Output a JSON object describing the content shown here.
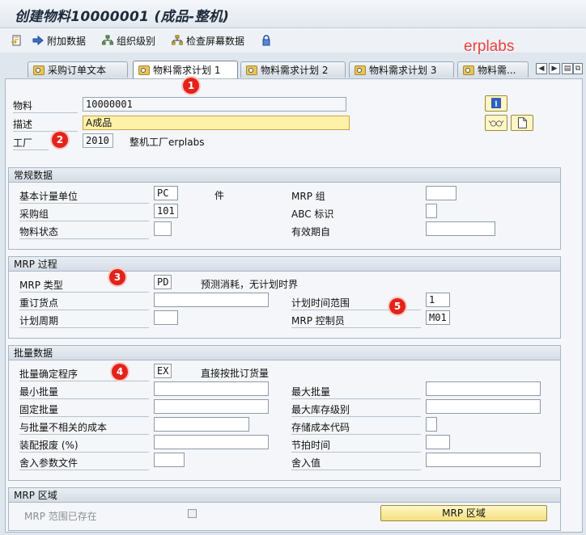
{
  "window": {
    "title": "创建物料10000001 (成品-整机)",
    "brand": "erplabs"
  },
  "toolbar": {
    "items": [
      "附加数据",
      "组织级别",
      "检查屏幕数据"
    ]
  },
  "tabs": [
    "采购订单文本",
    "物料需求计划 1",
    "物料需求计划 2",
    "物料需求计划 3",
    "物料需..."
  ],
  "header": {
    "material_label": "物料",
    "material_value": "10000001",
    "desc_label": "描述",
    "desc_value": "A成品",
    "plant_label": "工厂",
    "plant_value": "2010",
    "plant_text": "整机工厂erplabs"
  },
  "general": {
    "title": "常规数据",
    "base_uom_label": "基本计量单位",
    "base_uom_value": "PC",
    "base_uom_text": "件",
    "mrp_group_label": "MRP 组",
    "mrp_group_value": "",
    "purch_group_label": "采购组",
    "purch_group_value": "101",
    "abc_label": "ABC 标识",
    "abc_value": "",
    "status_label": "物料状态",
    "status_value": "",
    "valid_from_label": "有效期自",
    "valid_from_value": ""
  },
  "mrp_proc": {
    "title": "MRP 过程",
    "type_label": "MRP 类型",
    "type_value": "PD",
    "type_text": "预测消耗，无计划时界",
    "reorder_label": "重订货点",
    "reorder_value": "",
    "horizon_label": "计划时间范围",
    "horizon_value": "1",
    "cycle_label": "计划周期",
    "cycle_value": "",
    "controller_label": "MRP 控制员",
    "controller_value": "M01"
  },
  "lot": {
    "title": "批量数据",
    "proc_label": "批量确定程序",
    "proc_value": "EX",
    "proc_text": "直接按批订货量",
    "min_label": "最小批量",
    "min_value": "",
    "max_label": "最大批量",
    "max_value": "",
    "fixed_label": "固定批量",
    "fixed_value": "",
    "maxstock_label": "最大库存级别",
    "maxstock_value": "",
    "cost_label": "与批量不相关的成本",
    "cost_value": "",
    "storcost_label": "存储成本代码",
    "storcost_value": "",
    "scrap_label": "装配报废 (%)",
    "scrap_value": "",
    "takt_label": "节拍时间",
    "takt_value": "",
    "round_profile_label": "舍入参数文件",
    "round_profile_value": "",
    "round_value_label": "舍入值",
    "round_value_value": ""
  },
  "area": {
    "title": "MRP 区域",
    "exists_label": "MRP 范围已存在",
    "button_label": "MRP 区域"
  },
  "badges": [
    "1",
    "2",
    "3",
    "4",
    "5"
  ],
  "colors": {
    "badge": "#e3231b",
    "brand": "#e8423b",
    "highlight": "#fff2a8"
  }
}
